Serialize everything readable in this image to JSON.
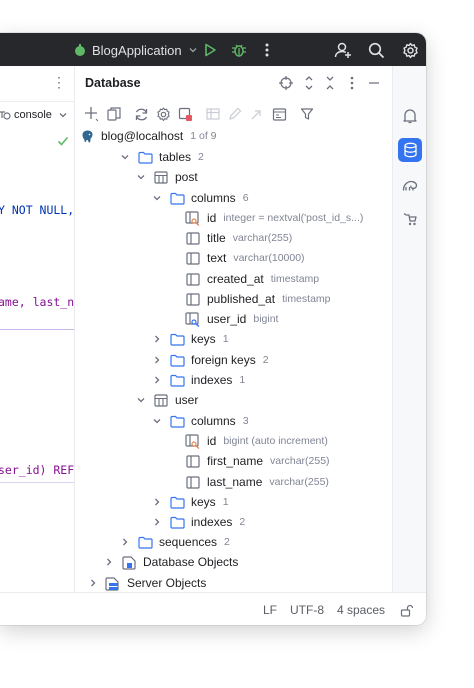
{
  "titlebar": {
    "run_config": "BlogApplication",
    "icons": [
      "run-config-icon",
      "chevron-down-icon",
      "run-icon",
      "debug-icon",
      "more-vertical-icon",
      "add-user-icon",
      "search-icon",
      "settings-icon"
    ]
  },
  "editor": {
    "console_label": "console",
    "code_line_1": "Y NOT NULL,",
    "code_line_2": "ame, last_na",
    "code_line_3": "ser_id) REFE"
  },
  "database_panel": {
    "title": "Database",
    "connection": "blog@localhost",
    "connection_count": "1 of 9",
    "tree": [
      {
        "label": "tables",
        "hint": "2"
      },
      {
        "label": "post",
        "hint": ""
      },
      {
        "label": "columns",
        "hint": "6"
      },
      {
        "label": "id",
        "hint": "integer = nextval('post_id_s...)"
      },
      {
        "label": "title",
        "hint": "varchar(255)"
      },
      {
        "label": "text",
        "hint": "varchar(10000)"
      },
      {
        "label": "created_at",
        "hint": "timestamp"
      },
      {
        "label": "published_at",
        "hint": "timestamp"
      },
      {
        "label": "user_id",
        "hint": "bigint"
      },
      {
        "label": "keys",
        "hint": "1"
      },
      {
        "label": "foreign keys",
        "hint": "2"
      },
      {
        "label": "indexes",
        "hint": "1"
      },
      {
        "label": "user",
        "hint": ""
      },
      {
        "label": "columns",
        "hint": "3"
      },
      {
        "label": "id",
        "hint": "bigint (auto increment)"
      },
      {
        "label": "first_name",
        "hint": "varchar(255)"
      },
      {
        "label": "last_name",
        "hint": "varchar(255)"
      },
      {
        "label": "keys",
        "hint": "1"
      },
      {
        "label": "indexes",
        "hint": "2"
      },
      {
        "label": "sequences",
        "hint": "2"
      },
      {
        "label": "Database Objects",
        "hint": ""
      },
      {
        "label": "Server Objects",
        "hint": ""
      }
    ]
  },
  "statusbar": {
    "line_separator": "LF",
    "encoding": "UTF-8",
    "indent": "4 spaces"
  },
  "colors": {
    "accent": "#3574f0",
    "titlebar_bg": "#27282c",
    "run_green": "#5fb865",
    "debug_green": "#5fb865",
    "folder": "#3574f0",
    "key_orange": "#e08855"
  }
}
